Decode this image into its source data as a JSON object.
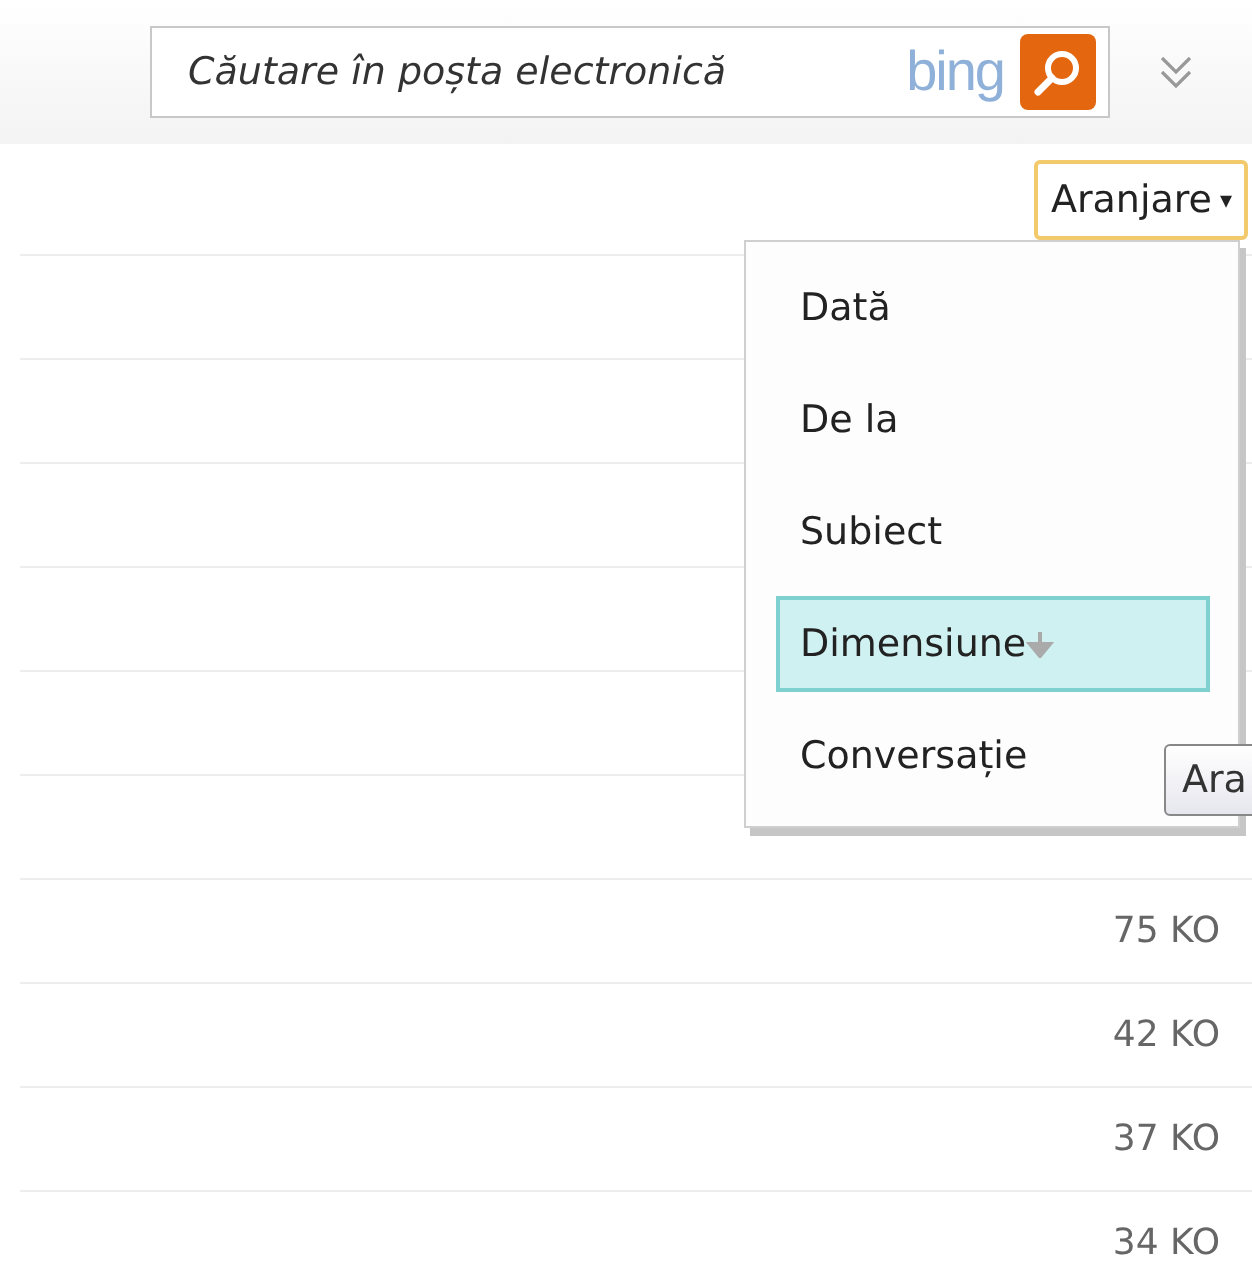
{
  "search": {
    "placeholder": "Căutare în poșta electronică",
    "logo": "bing"
  },
  "sort_button": {
    "label": "Aranjare",
    "caret": "▾"
  },
  "sort_menu": {
    "items": [
      {
        "label": "Dată",
        "selected": false
      },
      {
        "label": "De la",
        "selected": false
      },
      {
        "label": "Subiect",
        "selected": false
      },
      {
        "label": "Dimensiune",
        "selected": true
      },
      {
        "label": "Conversație",
        "selected": false
      }
    ]
  },
  "tooltip": "Ara",
  "rows": [
    {
      "size": "75 KO"
    },
    {
      "size": "42 KO"
    },
    {
      "size": "37 KO"
    },
    {
      "size": "34 KO"
    }
  ]
}
